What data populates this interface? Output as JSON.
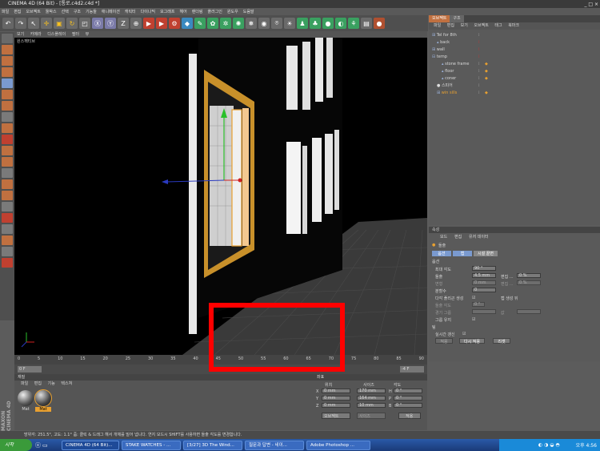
{
  "window": {
    "title": "CINEMA 4D (64 Bit) - [통로.c4d2.c4d *]",
    "controls": "_ □ ×"
  },
  "menubar": [
    "파일",
    "편집",
    "오브젝트",
    "툴박스",
    "선택",
    "구조",
    "기능들",
    "애니메이션",
    "캐릭터",
    "다이나믹",
    "모그래프",
    "헤어",
    "렌더링",
    "플러그인",
    "윈도우",
    "도움말"
  ],
  "viewport": {
    "tabs": [
      "보기",
      "카메라",
      "디스플레이",
      "필터",
      "뷰"
    ],
    "label": "원스펙티브"
  },
  "timeline": {
    "ticks": [
      "0",
      "5",
      "10",
      "15",
      "20",
      "25",
      "30",
      "35",
      "40",
      "45",
      "50",
      "55",
      "60",
      "65",
      "70",
      "75",
      "80",
      "85",
      "90"
    ],
    "start_frame": "0 F",
    "end_frame": "-4 F"
  },
  "object_manager": {
    "tabs": [
      "오브젝트",
      "구조"
    ],
    "menu": [
      "파일",
      "편집",
      "보기",
      "오브젝트",
      "태그",
      "북마크"
    ],
    "items": [
      {
        "name": "Tel for 8th",
        "indent": 0,
        "icon": "null-icon"
      },
      {
        "name": "back",
        "indent": 1,
        "icon": "polygon-icon"
      },
      {
        "name": "wall",
        "indent": 0,
        "icon": "null-icon"
      },
      {
        "name": "temp",
        "indent": 0,
        "icon": "null-icon"
      },
      {
        "name": "stone frame",
        "indent": 2,
        "icon": "polygon-icon"
      },
      {
        "name": "floor",
        "indent": 2,
        "icon": "polygon-icon"
      },
      {
        "name": "coner",
        "indent": 2,
        "icon": "polygon-icon"
      },
      {
        "name": "스피어",
        "indent": 1,
        "icon": "sphere-icon"
      },
      {
        "name": "win sills",
        "indent": 1,
        "icon": "null-icon",
        "selected": true
      }
    ]
  },
  "attributes": {
    "header": "속성",
    "menu": [
      "모드",
      "편집",
      "유저 데이터"
    ],
    "object_name": "돌출",
    "tabs": [
      "옵션",
      "캡",
      "시설 끝면"
    ],
    "section": "옵션",
    "fields": [
      {
        "label": "최대 각도",
        "value": "90 °"
      },
      {
        "label": "돌출",
        "value": "4.5 mm",
        "label2": "편집 ...",
        "value2": "0 %"
      },
      {
        "label": "변형",
        "value": "0 mm",
        "label2": "편집 ...",
        "value2": "0 %"
      },
      {
        "label": "분할수",
        "value": "0"
      },
      {
        "label": "다각 플리곤 생성",
        "value": "",
        "label2": "캡 생성 뒤",
        "value2": ""
      },
      {
        "label": "돌출 각도",
        "value": "0 °"
      },
      {
        "label": "경기 그룹",
        "value": "",
        "label2": "값",
        "value2": ""
      },
      {
        "label": "그룹 유지",
        "value": ""
      }
    ],
    "subheader": "팀",
    "realtime_label": "실시간 갱신",
    "buttons": [
      "적용",
      "다시 적용",
      "리셋"
    ]
  },
  "materials": {
    "header": "재질",
    "menu": [
      "파일",
      "편집",
      "기능",
      "텍스쳐"
    ],
    "items": [
      "Mat",
      "Mat"
    ]
  },
  "coordinates": {
    "header": "좌표",
    "cols": [
      "위치",
      "사이즈",
      "각도"
    ],
    "rows": [
      {
        "axis": "X",
        "pos": "0 mm",
        "size": "170 mm",
        "rlabel": "H",
        "rot": "0 °"
      },
      {
        "axis": "Y",
        "pos": "0 mm",
        "size": "164 mm",
        "rlabel": "P",
        "rot": "0 °"
      },
      {
        "axis": "Z",
        "pos": "0 mm",
        "size": "10 mm",
        "rlabel": "B",
        "rot": "0 °"
      }
    ],
    "mode": "오브젝트",
    "size_mode": "사이즈",
    "apply": "적용"
  },
  "status": "방위각: 251.5°, 고도: 1.1° 줌: 클릭 & 드래그 해서 개체를 밀어 냅니다. 연지 모드시 SHIFT를 사용하면 돌출 각도를 변경합니다.",
  "taskbar": {
    "start": "시작",
    "tasks": [
      "CINEMA 4D (64 Bit)...",
      "STAKE WATCHES - ...",
      "[3/27] 3D The Wind...",
      "질문과 답변 - 네이...",
      "Adobe Photoshop ..."
    ],
    "clock": "오후 4:56"
  },
  "maxon": "MAXON CINEMA 4D",
  "colors": {
    "accent_red": "#ff0000",
    "selected_orange": "#e8a030",
    "tab_blue": "#7a9ad0"
  }
}
